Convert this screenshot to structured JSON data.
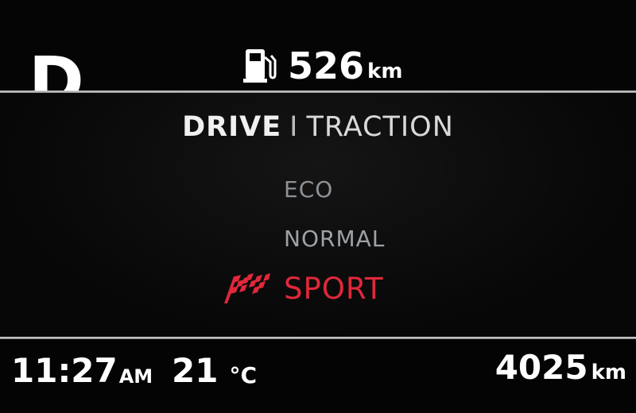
{
  "gear": {
    "indicator": "D"
  },
  "range": {
    "icon": "fuel-pump-icon",
    "value": "526",
    "unit": "km"
  },
  "menu": {
    "title_primary": "DRIVE",
    "separator": "I",
    "title_secondary": "TRACTION",
    "modes": [
      {
        "label": "ECO",
        "selected": false
      },
      {
        "label": "NORMAL",
        "selected": false
      },
      {
        "label": "SPORT",
        "selected": true,
        "icon": "checkered-flag-icon"
      }
    ]
  },
  "status_bar": {
    "time": "11:27",
    "ampm": "AM",
    "temperature": "21",
    "temperature_unit": "°C",
    "odometer": "4025",
    "odometer_unit": "km"
  },
  "colors": {
    "selected_mode": "#e0283a",
    "unselected_mode": "#8d9297",
    "background": "#030303",
    "separator_line": "#cfcfcf"
  }
}
